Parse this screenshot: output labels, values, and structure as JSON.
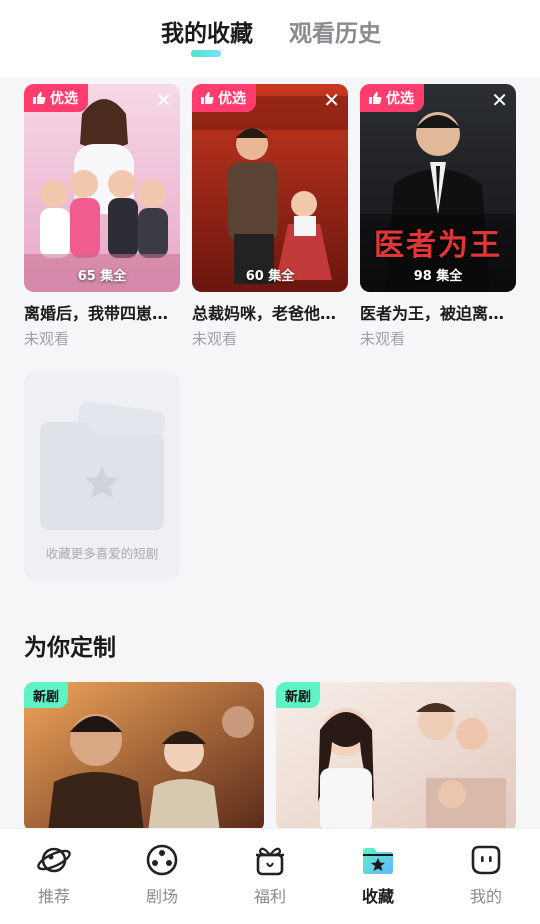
{
  "tabs": {
    "favorites": "我的收藏",
    "history": "观看历史"
  },
  "favorites": [
    {
      "badge": "优选",
      "episodes": "65 集全",
      "title": "离婚后，我带四崽…",
      "status": "未观看"
    },
    {
      "badge": "优选",
      "episodes": "60 集全",
      "title": "总裁妈咪，老爸他…",
      "status": "未观看"
    },
    {
      "badge": "优选",
      "episodes": "98 集全",
      "title": "医者为王，被迫离…",
      "status": "未观看",
      "poster_text": "医者为王"
    }
  ],
  "empty_card": {
    "hint": "收藏更多喜爱的短剧"
  },
  "section": {
    "title": "为你定制"
  },
  "recommendations": [
    {
      "badge": "新剧"
    },
    {
      "badge": "新剧"
    }
  ],
  "bottom_nav": [
    {
      "label": "推荐",
      "icon": "planet-icon"
    },
    {
      "label": "剧场",
      "icon": "film-reel-icon"
    },
    {
      "label": "福利",
      "icon": "gift-icon"
    },
    {
      "label": "收藏",
      "icon": "folder-star-icon",
      "active": true
    },
    {
      "label": "我的",
      "icon": "profile-face-icon"
    }
  ],
  "colors": {
    "accent_pink": "#ff3c6e",
    "accent_mint": "#5ef2c4",
    "indicator": "#4fe3c6"
  }
}
